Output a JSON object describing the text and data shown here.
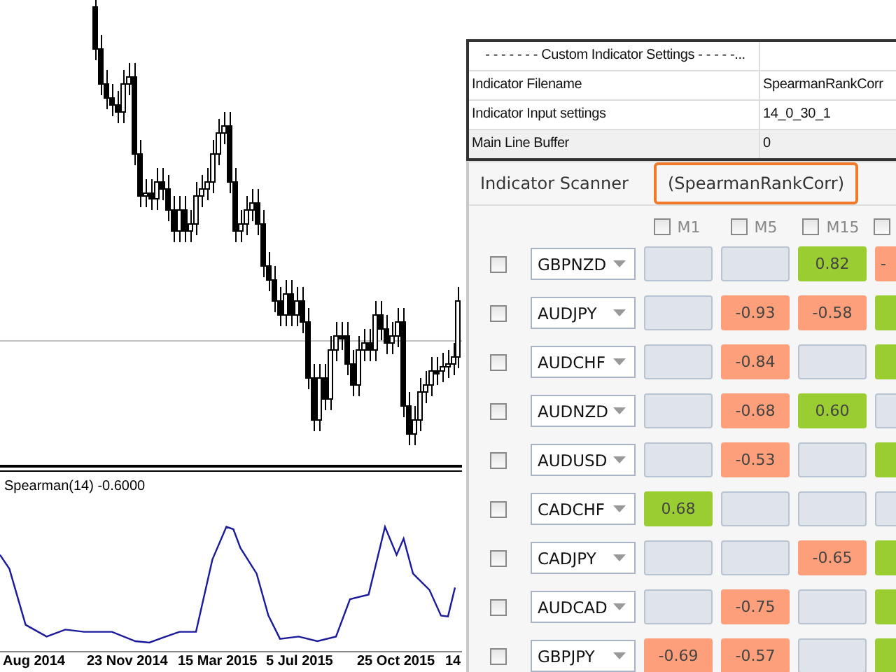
{
  "chart": {
    "indicator_label": "Spearman(14) -0.6000",
    "date_labels": [
      "Aug 2014",
      "23 Nov 2014",
      "15 Mar 2015",
      "5 Jul 2015",
      "25 Oct 2015",
      "14"
    ]
  },
  "settings": {
    "header": "- - - - - - - Custom Indicator Settings - - - - -...",
    "rows": [
      {
        "label": "Indicator Filename",
        "value": "SpearmanRankCorr"
      },
      {
        "label": "Indicator Input settings",
        "value": "14_0_30_1"
      },
      {
        "label": "Main Line Buffer",
        "value": "0"
      }
    ]
  },
  "scanner": {
    "tabs": [
      {
        "label": "Indicator Scanner",
        "highlighted": false
      },
      {
        "label": "(SpearmanRankCorr)",
        "highlighted": true
      }
    ],
    "columns": [
      {
        "label": "M1",
        "checked": false
      },
      {
        "label": "M5",
        "checked": false
      },
      {
        "label": "M15",
        "checked": false
      },
      {
        "checked": false
      }
    ],
    "rows": [
      {
        "symbol": "GBPNZD",
        "checked": false,
        "cells": [
          {
            "kind": "none"
          },
          {
            "kind": "none"
          },
          {
            "kind": "positive",
            "value": "0.82"
          },
          {
            "kind": "negative",
            "value": "-"
          }
        ]
      },
      {
        "symbol": "AUDJPY",
        "checked": false,
        "cells": [
          {
            "kind": "none"
          },
          {
            "kind": "negative",
            "value": "-0.93"
          },
          {
            "kind": "negative",
            "value": "-0.58"
          },
          {
            "kind": "positive"
          }
        ]
      },
      {
        "symbol": "AUDCHF",
        "checked": false,
        "cells": [
          {
            "kind": "none"
          },
          {
            "kind": "negative",
            "value": "-0.84"
          },
          {
            "kind": "none"
          },
          {
            "kind": "positive"
          }
        ]
      },
      {
        "symbol": "AUDNZD",
        "checked": false,
        "cells": [
          {
            "kind": "none"
          },
          {
            "kind": "negative",
            "value": "-0.68"
          },
          {
            "kind": "positive",
            "value": "0.60"
          },
          {
            "kind": "none"
          }
        ]
      },
      {
        "symbol": "AUDUSD",
        "checked": false,
        "cells": [
          {
            "kind": "none"
          },
          {
            "kind": "negative",
            "value": "-0.53"
          },
          {
            "kind": "none"
          },
          {
            "kind": "positive"
          }
        ]
      },
      {
        "symbol": "CADCHF",
        "checked": false,
        "cells": [
          {
            "kind": "positive",
            "value": "0.68"
          },
          {
            "kind": "none"
          },
          {
            "kind": "none"
          },
          {
            "kind": "none"
          }
        ]
      },
      {
        "symbol": "CADJPY",
        "checked": false,
        "cells": [
          {
            "kind": "none"
          },
          {
            "kind": "none"
          },
          {
            "kind": "negative",
            "value": "-0.65"
          },
          {
            "kind": "positive"
          }
        ]
      },
      {
        "symbol": "AUDCAD",
        "checked": false,
        "cells": [
          {
            "kind": "none"
          },
          {
            "kind": "negative",
            "value": "-0.75"
          },
          {
            "kind": "none"
          },
          {
            "kind": "positive"
          }
        ]
      },
      {
        "symbol": "GBPJPY",
        "checked": false,
        "cells": [
          {
            "kind": "negative",
            "value": "-0.69"
          },
          {
            "kind": "negative",
            "value": "-0.57"
          },
          {
            "kind": "none"
          },
          {
            "kind": "positive"
          }
        ]
      }
    ]
  }
}
